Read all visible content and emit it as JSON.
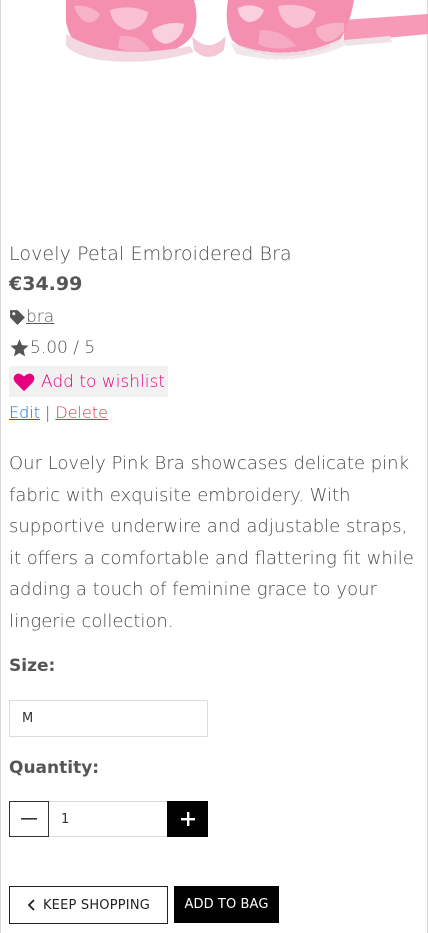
{
  "product": {
    "title": "Lovely Petal Embroidered Bra",
    "price": "€34.99",
    "category_tag": "bra",
    "rating": "5.00 / 5",
    "image_alt": "pink embroidered bra"
  },
  "actions": {
    "wishlist_label": "Add to wishlist",
    "edit_label": "Edit",
    "separator": "|",
    "delete_label": "Delete"
  },
  "description": "Our Lovely Pink Bra showcases delicate pink fabric with exquisite embroidery. With supportive underwire and adjustable straps, it offers a comfortable and flattering fit while adding a touch of feminine grace to your lingerie collection.",
  "size": {
    "label": "Size:",
    "selected": "M"
  },
  "quantity": {
    "label": "Quantity:",
    "value": "1"
  },
  "buttons": {
    "keep_shopping": "KEEP SHOPPING",
    "add_to_bag": "ADD TO BAG"
  },
  "colors": {
    "accent_pink": "#e6007e",
    "edit_blue": "#0a6bd6",
    "delete_red": "#dc3545",
    "text": "#4a4a4a"
  },
  "icons": {
    "tag": "tag-icon",
    "star": "star-icon",
    "heart": "heart-icon",
    "chevron": "chevron-left-icon",
    "minus": "minus-icon",
    "plus": "plus-icon"
  }
}
